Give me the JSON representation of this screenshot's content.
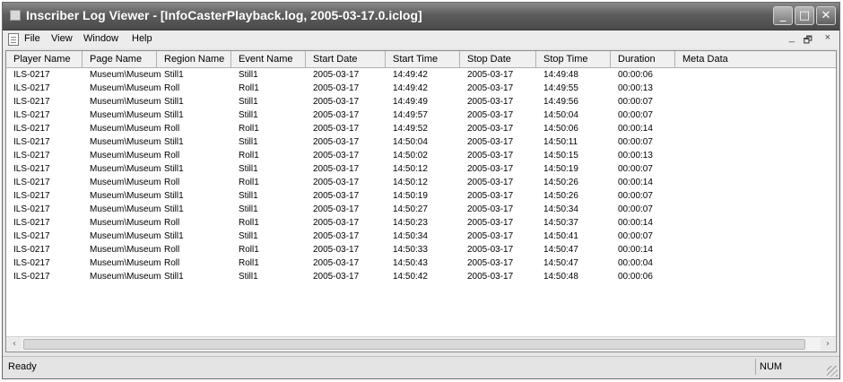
{
  "window": {
    "title": "Inscriber Log Viewer - [InfoCasterPlayback.log, 2005-03-17.0.iclog]",
    "minimize_glyph": "_",
    "maximize_glyph": "□",
    "close_glyph": "✕"
  },
  "menu": {
    "items": [
      "File",
      "View",
      "Window",
      "Help"
    ],
    "mdi_buttons": [
      "_",
      "🗗",
      "×"
    ]
  },
  "table": {
    "columns": [
      "Player Name",
      "Page Name",
      "Region Name",
      "Event Name",
      "Start Date",
      "Start Time",
      "Stop Date",
      "Stop Time",
      "Duration",
      "Meta Data"
    ],
    "rows": [
      [
        "ILS-0217",
        "Museum\\Museum",
        "Still1",
        "Still1",
        "2005-03-17",
        "14:49:42",
        "2005-03-17",
        "14:49:48",
        "00:00:06",
        ""
      ],
      [
        "ILS-0217",
        "Museum\\Museum",
        "Roll",
        "Roll1",
        "2005-03-17",
        "14:49:42",
        "2005-03-17",
        "14:49:55",
        "00:00:13",
        ""
      ],
      [
        "ILS-0217",
        "Museum\\Museum",
        "Still1",
        "Still1",
        "2005-03-17",
        "14:49:49",
        "2005-03-17",
        "14:49:56",
        "00:00:07",
        ""
      ],
      [
        "ILS-0217",
        "Museum\\Museum",
        "Still1",
        "Still1",
        "2005-03-17",
        "14:49:57",
        "2005-03-17",
        "14:50:04",
        "00:00:07",
        ""
      ],
      [
        "ILS-0217",
        "Museum\\Museum",
        "Roll",
        "Roll1",
        "2005-03-17",
        "14:49:52",
        "2005-03-17",
        "14:50:06",
        "00:00:14",
        ""
      ],
      [
        "ILS-0217",
        "Museum\\Museum",
        "Still1",
        "Still1",
        "2005-03-17",
        "14:50:04",
        "2005-03-17",
        "14:50:11",
        "00:00:07",
        ""
      ],
      [
        "ILS-0217",
        "Museum\\Museum",
        "Roll",
        "Roll1",
        "2005-03-17",
        "14:50:02",
        "2005-03-17",
        "14:50:15",
        "00:00:13",
        ""
      ],
      [
        "ILS-0217",
        "Museum\\Museum",
        "Still1",
        "Still1",
        "2005-03-17",
        "14:50:12",
        "2005-03-17",
        "14:50:19",
        "00:00:07",
        ""
      ],
      [
        "ILS-0217",
        "Museum\\Museum",
        "Roll",
        "Roll1",
        "2005-03-17",
        "14:50:12",
        "2005-03-17",
        "14:50:26",
        "00:00:14",
        ""
      ],
      [
        "ILS-0217",
        "Museum\\Museum",
        "Still1",
        "Still1",
        "2005-03-17",
        "14:50:19",
        "2005-03-17",
        "14:50:26",
        "00:00:07",
        ""
      ],
      [
        "ILS-0217",
        "Museum\\Museum",
        "Still1",
        "Still1",
        "2005-03-17",
        "14:50:27",
        "2005-03-17",
        "14:50:34",
        "00:00:07",
        ""
      ],
      [
        "ILS-0217",
        "Museum\\Museum",
        "Roll",
        "Roll1",
        "2005-03-17",
        "14:50:23",
        "2005-03-17",
        "14:50:37",
        "00:00:14",
        ""
      ],
      [
        "ILS-0217",
        "Museum\\Museum",
        "Still1",
        "Still1",
        "2005-03-17",
        "14:50:34",
        "2005-03-17",
        "14:50:41",
        "00:00:07",
        ""
      ],
      [
        "ILS-0217",
        "Museum\\Museum",
        "Roll",
        "Roll1",
        "2005-03-17",
        "14:50:33",
        "2005-03-17",
        "14:50:47",
        "00:00:14",
        ""
      ],
      [
        "ILS-0217",
        "Museum\\Museum",
        "Roll",
        "Roll1",
        "2005-03-17",
        "14:50:43",
        "2005-03-17",
        "14:50:47",
        "00:00:04",
        ""
      ],
      [
        "ILS-0217",
        "Museum\\Museum",
        "Still1",
        "Still1",
        "2005-03-17",
        "14:50:42",
        "2005-03-17",
        "14:50:48",
        "00:00:06",
        ""
      ]
    ]
  },
  "scrollbar": {
    "left_arrow": "‹",
    "right_arrow": "›"
  },
  "status": {
    "text": "Ready",
    "panel": "NUM"
  }
}
